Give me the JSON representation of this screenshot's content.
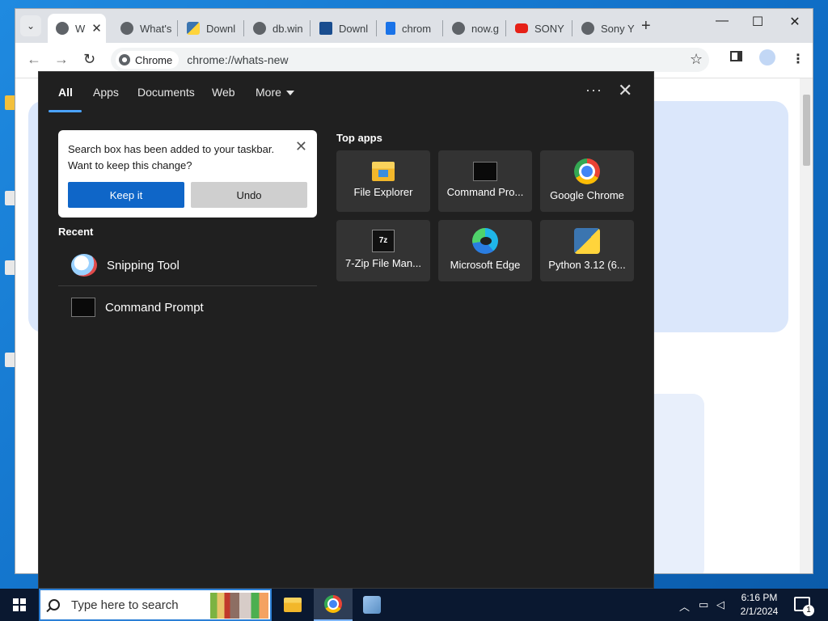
{
  "browser": {
    "tabs": [
      {
        "label": "W",
        "color": "#5f6368"
      },
      {
        "label": "What's",
        "color": "#5f6368"
      },
      {
        "label": "Downl",
        "color": "#3b75b0"
      },
      {
        "label": "db.win",
        "color": "#5f6368"
      },
      {
        "label": "Downl",
        "color": "#1a4d8f"
      },
      {
        "label": "chrom",
        "color": "#1a73e8"
      },
      {
        "label": "now.g",
        "color": "#5f6368"
      },
      {
        "label": "SONY",
        "color": "#e62117"
      },
      {
        "label": "Sony Y",
        "color": "#5f6368"
      }
    ],
    "new_tab": "+",
    "minimize": "—",
    "maximize": "☐",
    "close": "✕",
    "back": "←",
    "forward": "→",
    "reload": "↻",
    "chip_label": "Chrome",
    "url": "chrome://whats-new",
    "star": "☆",
    "tab_close": "✕",
    "tab_search": "⌄"
  },
  "search_panel": {
    "tabs": [
      "All",
      "Apps",
      "Documents",
      "Web",
      "More"
    ],
    "more_label": "More",
    "dots": "···",
    "close": "✕",
    "notice": {
      "message": "Search box has been added to your taskbar. Want to keep this change?",
      "keep": "Keep it",
      "undo": "Undo",
      "close": "✕"
    },
    "recent_title": "Recent",
    "recent": [
      {
        "label": "Snipping Tool",
        "icon": "snipping-tool-icon"
      },
      {
        "label": "Command Prompt",
        "icon": "command-prompt-icon"
      }
    ],
    "top_apps_title": "Top apps",
    "top_apps": [
      {
        "label": "File Explorer",
        "icon": "file-explorer-icon"
      },
      {
        "label": "Command Pro...",
        "icon": "command-prompt-icon"
      },
      {
        "label": "Google Chrome",
        "icon": "chrome-icon"
      },
      {
        "label": "7-Zip File Man...",
        "icon": "seven-zip-icon"
      },
      {
        "label": "Microsoft Edge",
        "icon": "edge-icon"
      },
      {
        "label": "Python 3.12 (6...",
        "icon": "python-icon"
      }
    ],
    "seven_zip_glyph": "7z"
  },
  "taskbar": {
    "search_placeholder": "Type here to search",
    "time": "6:16 PM",
    "date": "2/1/2024",
    "notification_count": "1",
    "tray_chevron": "︿"
  },
  "colors": {
    "accent": "#0f66c8",
    "panel_bg": "#202020",
    "tile_bg": "#333333",
    "taskbar_bg": "#0a1830"
  }
}
